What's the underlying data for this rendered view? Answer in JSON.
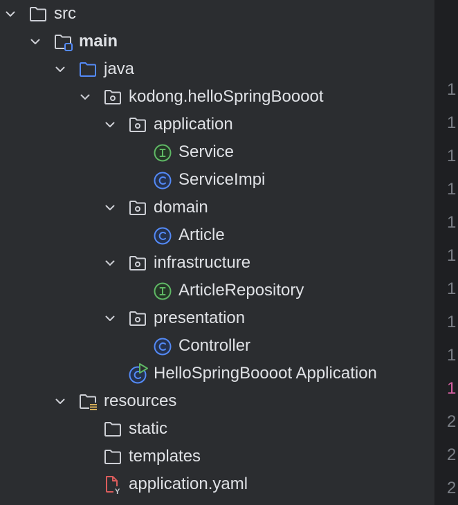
{
  "tree": [
    {
      "name": "src",
      "icon": "folder-icon",
      "expanded": true,
      "bold": false
    },
    {
      "name": "main",
      "icon": "source-root-folder-icon",
      "expanded": true,
      "bold": true
    },
    {
      "name": "java",
      "icon": "java-source-folder-icon",
      "expanded": true,
      "bold": false
    },
    {
      "name": "kodong.helloSpringBoooot",
      "icon": "package-icon",
      "expanded": true,
      "bold": false
    },
    {
      "name": "application",
      "icon": "package-icon",
      "expanded": true,
      "bold": false
    },
    {
      "name": "Service",
      "icon": "interface-icon",
      "bold": false
    },
    {
      "name": "ServiceImpi",
      "icon": "class-icon",
      "bold": false
    },
    {
      "name": "domain",
      "icon": "package-icon",
      "expanded": true,
      "bold": false
    },
    {
      "name": "Article",
      "icon": "class-icon",
      "bold": false
    },
    {
      "name": "infrastructure",
      "icon": "package-icon",
      "expanded": true,
      "bold": false
    },
    {
      "name": "ArticleRepository",
      "icon": "interface-icon",
      "bold": false
    },
    {
      "name": "presentation",
      "icon": "package-icon",
      "expanded": true,
      "bold": false
    },
    {
      "name": "Controller",
      "icon": "class-icon",
      "bold": false
    },
    {
      "name": "HelloSpringBoooot Application",
      "icon": "spring-boot-application-icon",
      "bold": false
    },
    {
      "name": "resources",
      "icon": "resources-folder-icon",
      "expanded": true,
      "bold": false
    },
    {
      "name": "static",
      "icon": "folder-icon",
      "bold": false
    },
    {
      "name": "templates",
      "icon": "folder-icon",
      "bold": false
    },
    {
      "name": "application.yaml",
      "icon": "yaml-file-icon",
      "bold": false
    }
  ],
  "gutter": {
    "line_numbers": [
      "1",
      "1",
      "1",
      "1",
      "1",
      "1",
      "1",
      "1",
      "1",
      "1",
      "2",
      "2",
      "2"
    ],
    "active_index": 9
  },
  "colors": {
    "background": "#2b2d30",
    "editor_background": "#1e1f22",
    "text": "#dfe1e5",
    "icon_gray": "#ced0d6",
    "folder_blue": "#548af7",
    "interface_green": "#5fb865",
    "class_blue": "#548af7",
    "yaml_red": "#db5c5c",
    "resources_yellow": "#d6ae58",
    "active_line_number": "#d45fa0",
    "line_number": "#7a7e85"
  }
}
